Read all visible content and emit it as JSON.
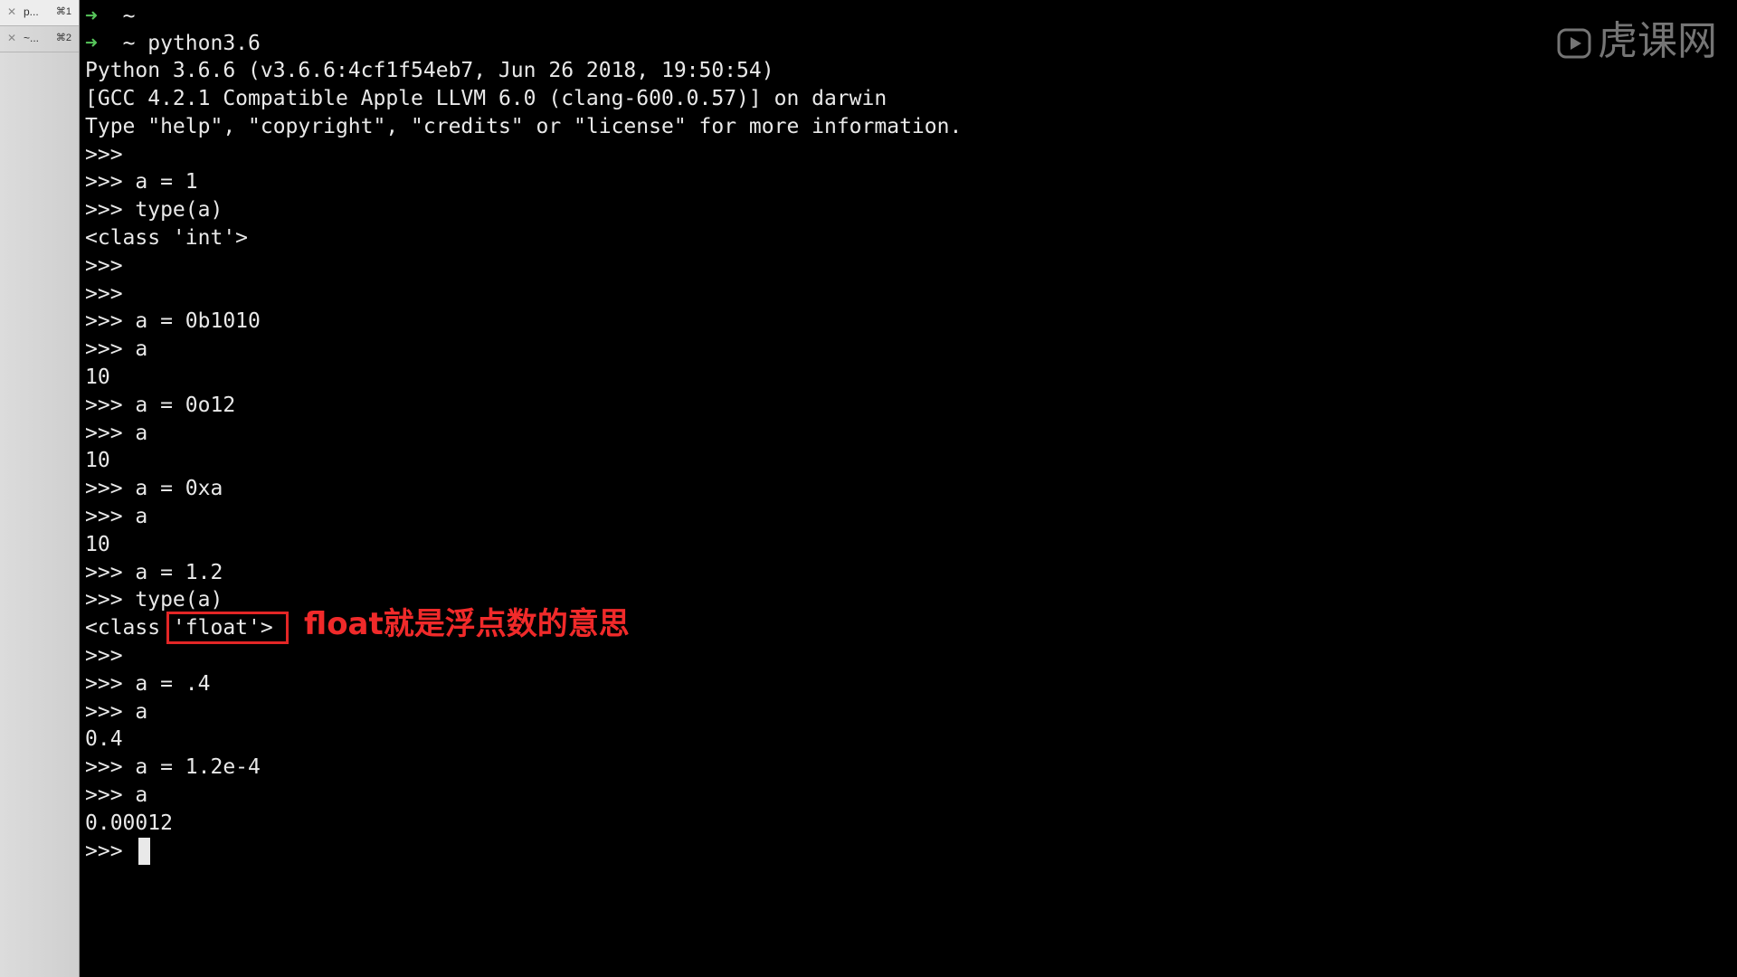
{
  "tabs": [
    {
      "name": "p...",
      "shortcut": "⌘1"
    },
    {
      "name": "~...",
      "shortcut": "⌘2"
    }
  ],
  "prompt": {
    "symbol": "➜",
    "dir": "~"
  },
  "lines": [
    "~",
    "~ python3.6",
    "Python 3.6.6 (v3.6.6:4cf1f54eb7, Jun 26 2018, 19:50:54)",
    "[GCC 4.2.1 Compatible Apple LLVM 6.0 (clang-600.0.57)] on darwin",
    "Type \"help\", \"copyright\", \"credits\" or \"license\" for more information.",
    ">>>",
    ">>> a = 1",
    ">>> type(a)",
    "<class 'int'>",
    ">>>",
    ">>>",
    ">>> a = 0b1010",
    ">>> a",
    "10",
    ">>> a = 0o12",
    ">>> a",
    "10",
    ">>> a = 0xa",
    ">>> a",
    "10",
    ">>> a = 1.2",
    ">>> type(a)",
    "<class 'float'>",
    ">>>",
    ">>> a = .4",
    ">>> a",
    "0.4",
    ">>> a = 1.2e-4",
    ">>> a",
    "0.00012",
    ">>>"
  ],
  "annotation": "float就是浮点数的意思",
  "watermark": "虎课网"
}
